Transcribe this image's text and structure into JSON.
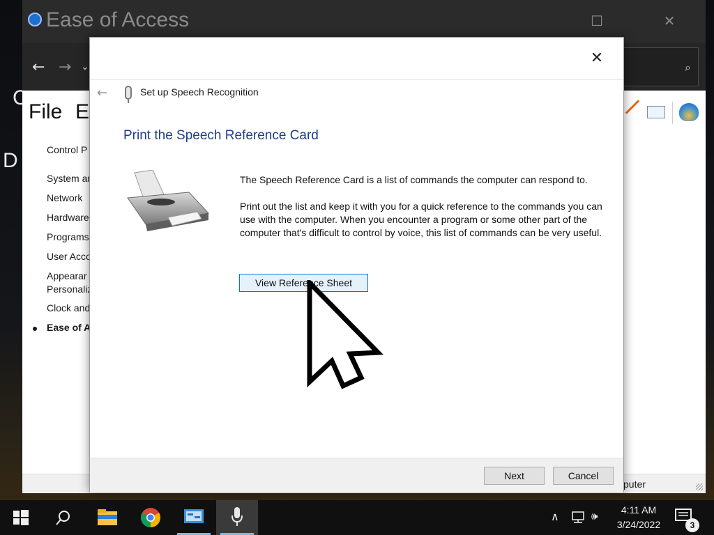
{
  "desktop": {
    "letter_c": "C",
    "letter_d": "D"
  },
  "control_panel": {
    "title": "Ease of Access",
    "menu": {
      "file": "File",
      "edit": "E"
    },
    "sidebar": [
      {
        "label": "Control P",
        "active": false
      },
      {
        "label": "System ar",
        "active": false
      },
      {
        "label": "Network",
        "active": false
      },
      {
        "label": "Hardware",
        "active": false
      },
      {
        "label": "Programs",
        "active": false
      },
      {
        "label": "User Acco",
        "active": false
      },
      {
        "label": "Appearar",
        "active": false
      },
      {
        "label": "Personaliz",
        "active": false
      },
      {
        "label": "Clock and",
        "active": false
      },
      {
        "label": "Ease of A",
        "active": true
      }
    ],
    "status_text": "puter"
  },
  "dialog": {
    "header_title": "Set up Speech Recognition",
    "heading": "Print the Speech Reference Card",
    "paragraph1": "The Speech Reference Card is a list of commands the computer can respond to.",
    "paragraph2": "Print out the list and keep it with you for a quick reference to the commands you can use with the computer. When you encounter a program or some other part of the computer that's difficult to control by voice, this list of commands can be very useful.",
    "view_button": "View Reference Sheet",
    "next_button": "Next",
    "cancel_button": "Cancel"
  },
  "taskbar": {
    "time": "4:11 AM",
    "date": "3/24/2022",
    "notification_count": "3"
  },
  "icons": {
    "close": "close-icon",
    "back": "back-arrow-icon",
    "microphone": "microphone-icon",
    "printer": "printer-icon",
    "cursor": "mouse-pointer-icon"
  },
  "colors": {
    "heading": "#1c3f86",
    "primary_button_border": "#0078d7",
    "primary_button_bg": "#e5f1fb"
  }
}
